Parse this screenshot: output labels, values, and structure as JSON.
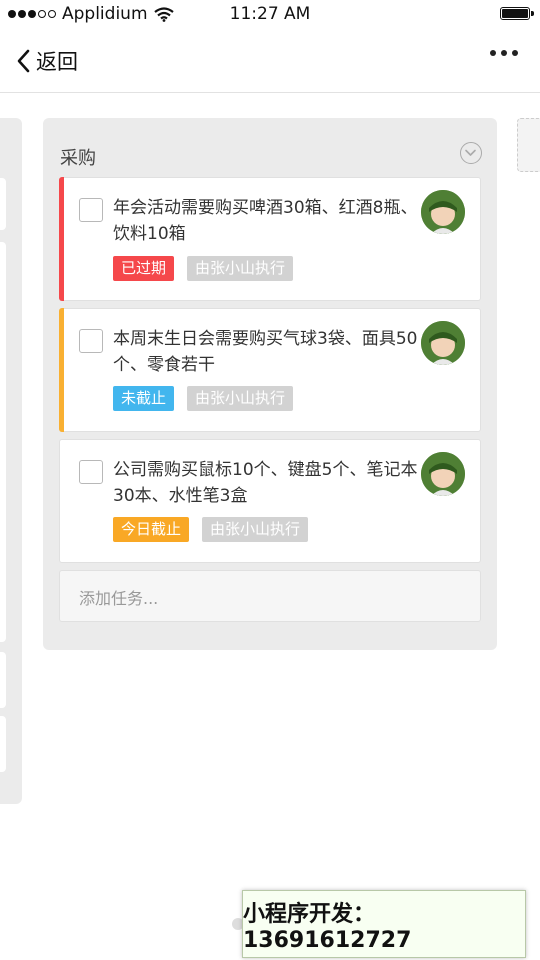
{
  "status_bar": {
    "carrier": "Applidium",
    "time": "11:27 AM",
    "signal_bars_filled": 3,
    "signal_bars_total": 5,
    "battery_level": 1.0
  },
  "nav": {
    "back_label": "返回"
  },
  "column": {
    "title": "采购",
    "cards": [
      {
        "text": "年会活动需要购买啤酒30箱、红酒8瓶、饮料10箱",
        "status": "已过期",
        "status_color": "#f5484b",
        "stripe_color": "#f5484b",
        "assignee": "由张小山执行"
      },
      {
        "text": "本周末生日会需要购买气球3袋、面具50个、零食若干",
        "status": "未截止",
        "status_color": "#42b6ee",
        "stripe_color": "#f9b032",
        "assignee": "由张小山执行"
      },
      {
        "text": "公司需购买鼠标10个、键盘5个、笔记本30本、水性笔3盒",
        "status": "今日截止",
        "status_color": "#f9a825",
        "stripe_color": "",
        "assignee": "由张小山执行"
      }
    ],
    "add_task_placeholder": "添加任务..."
  },
  "watermark": {
    "text": "小程序开发：13691612727"
  }
}
